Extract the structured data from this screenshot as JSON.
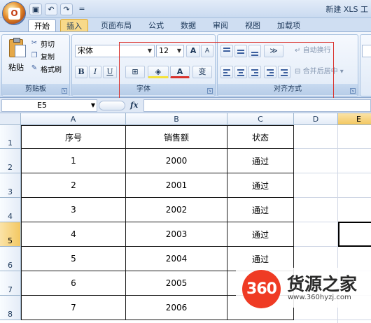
{
  "window": {
    "title": "新建 XLS 工"
  },
  "qat": {
    "save_icon": "save-icon",
    "undo_icon": "undo-icon",
    "redo_icon": "redo-icon",
    "customize": "="
  },
  "tabs": [
    {
      "label": "开始",
      "state": "active"
    },
    {
      "label": "插入",
      "state": "highlighted"
    },
    {
      "label": "页面布局"
    },
    {
      "label": "公式"
    },
    {
      "label": "数据"
    },
    {
      "label": "审阅"
    },
    {
      "label": "视图"
    },
    {
      "label": "加载项"
    }
  ],
  "clipboard": {
    "paste_label": "粘贴",
    "cut_label": "剪切",
    "copy_label": "复制",
    "format_painter_label": "格式刷",
    "group_label": "剪贴板"
  },
  "font": {
    "font_name": "宋体",
    "font_size": "12",
    "grow_label": "A",
    "shrink_label": "A",
    "bold": "B",
    "italic": "I",
    "underline": "U",
    "font_color_letter": "A",
    "phonetic_label": "变",
    "group_label": "字体"
  },
  "alignment": {
    "wrap_text_label": "自动换行",
    "merge_center_label": "合并后居中",
    "group_label": "对齐方式"
  },
  "formula_bar": {
    "name_box": "E5",
    "fx_label": "fx",
    "content": ""
  },
  "sheet": {
    "columns": [
      "A",
      "B",
      "C",
      "D",
      "E"
    ],
    "selected_column": "E",
    "rows": [
      "1",
      "2",
      "3",
      "4",
      "5",
      "6",
      "7",
      "8"
    ],
    "selected_row": "5",
    "headers": [
      "序号",
      "销售额",
      "状态"
    ],
    "data": [
      [
        "1",
        "2000",
        "通过"
      ],
      [
        "2",
        "2001",
        "通过"
      ],
      [
        "3",
        "2002",
        "通过"
      ],
      [
        "4",
        "2003",
        "通过"
      ],
      [
        "5",
        "2004",
        "通过"
      ],
      [
        "6",
        "2005",
        ""
      ],
      [
        "7",
        "2006",
        ""
      ]
    ]
  },
  "watermark": {
    "logo": "360",
    "text": "货源之家",
    "url": "www.360hyzj.com"
  },
  "colors": {
    "accent_red": "#d9302b",
    "ribbon": "#dbe7f6",
    "selected_header": "#f3c862"
  }
}
